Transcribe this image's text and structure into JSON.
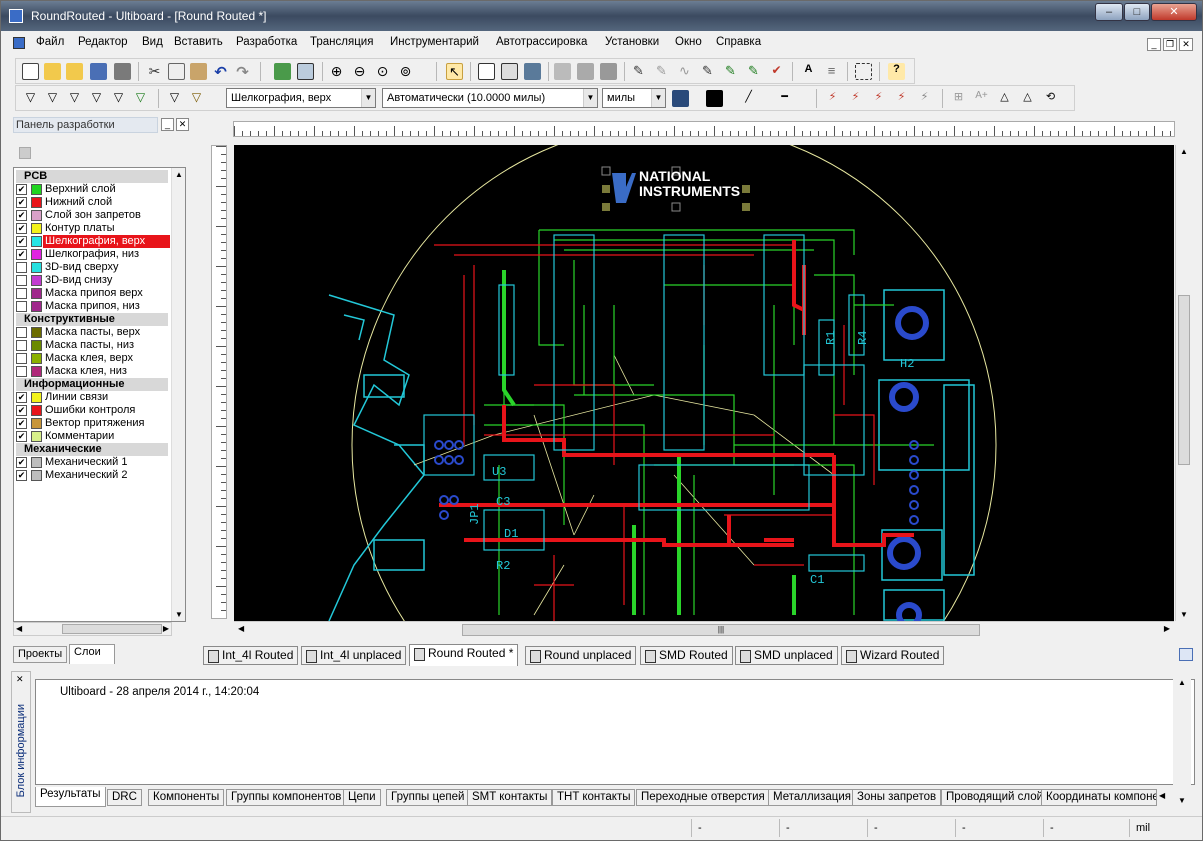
{
  "window": {
    "title": "RoundRouted - Ultiboard - [Round Routed *]",
    "minimize": "–",
    "maximize": "□",
    "close": "✕"
  },
  "menu": [
    "Файл",
    "Редактор",
    "Вид",
    "Вставить",
    "Разработка",
    "Трансляция",
    "Инструментарий",
    "Автотрассировка",
    "Установки",
    "Окно",
    "Справка"
  ],
  "toolbar": {
    "layer_combo": "Шелкография, верх",
    "grid_combo": "Автоматически (10.0000 милы)",
    "units_combo": "милы"
  },
  "panel": {
    "title": "Панель разработки",
    "groups": [
      {
        "name": "PCB",
        "items": [
          {
            "label": "Верхний слой",
            "color": "#1fd41f",
            "checked": true
          },
          {
            "label": "Нижний слой",
            "color": "#e8141a",
            "checked": true
          },
          {
            "label": "Слой зон запретов",
            "color": "#d9a0c8",
            "checked": true
          },
          {
            "label": "Контур платы",
            "color": "#f2f21a",
            "checked": true
          },
          {
            "label": "Шелкография, верх",
            "color": "#23e6e6",
            "checked": true,
            "selected": true
          },
          {
            "label": "Шелкография, низ",
            "color": "#e023e0",
            "checked": true
          },
          {
            "label": "3D-вид сверху",
            "color": "#26e0e0",
            "checked": false
          },
          {
            "label": "3D-вид снизу",
            "color": "#c23ad0",
            "checked": false
          },
          {
            "label": "Маска припоя верх",
            "color": "#a0288c",
            "checked": false
          },
          {
            "label": "Маска припоя, низ",
            "color": "#a0288c",
            "checked": false
          }
        ]
      },
      {
        "name": "Конструктивные",
        "items": [
          {
            "label": "Маска пасты, верх",
            "color": "#6b6b00",
            "checked": false
          },
          {
            "label": "Маска пасты, низ",
            "color": "#6b8a00",
            "checked": false
          },
          {
            "label": "Маска клея, верх",
            "color": "#8ab000",
            "checked": false
          },
          {
            "label": "Маска клея, низ",
            "color": "#b0287a",
            "checked": false
          }
        ]
      },
      {
        "name": "Информационные",
        "items": [
          {
            "label": "Линии связи",
            "color": "#f2f21a",
            "checked": true
          },
          {
            "label": "Ошибки контроля",
            "color": "#e8141a",
            "checked": true
          },
          {
            "label": "Вектор притяжения",
            "color": "#c8963a",
            "checked": true
          },
          {
            "label": "Комментарии",
            "color": "#d8f08a",
            "checked": true
          }
        ]
      },
      {
        "name": "Механические",
        "items": [
          {
            "label": "Механический 1",
            "color": "#bdbdbd",
            "checked": true
          },
          {
            "label": "Механический 2",
            "color": "#bdbdbd",
            "checked": true
          }
        ]
      }
    ],
    "tabs": [
      "Проекты",
      "Слои"
    ]
  },
  "board": {
    "logo_line1": "NATIONAL",
    "logo_line2": "INSTRUMENTS",
    "refs": [
      "U3",
      "D1",
      "R2",
      "C3",
      "C1",
      "R1",
      "R4",
      "H2",
      "JP1"
    ]
  },
  "doc_tabs": [
    "Int_4l Routed",
    "Int_4l unplaced",
    "Round Routed *",
    "Round unplaced",
    "SMD Routed",
    "SMD unplaced",
    "Wizard Routed"
  ],
  "info": {
    "side_label": "Блок информации",
    "message": "Ultiboard  -  28 апреля 2014 г., 14:20:04",
    "tabs": [
      "Результаты",
      "DRC",
      "Компоненты",
      "Группы компонентов",
      "Цепи",
      "Группы цепей",
      "SMT контакты",
      "THT контакты",
      "Переходные отверстия",
      "Металлизация",
      "Зоны запретов",
      "Проводящий слой",
      "Координаты компоне"
    ]
  },
  "status": {
    "cells": [
      "-",
      "-",
      "-",
      "-",
      "-",
      "mil"
    ]
  }
}
